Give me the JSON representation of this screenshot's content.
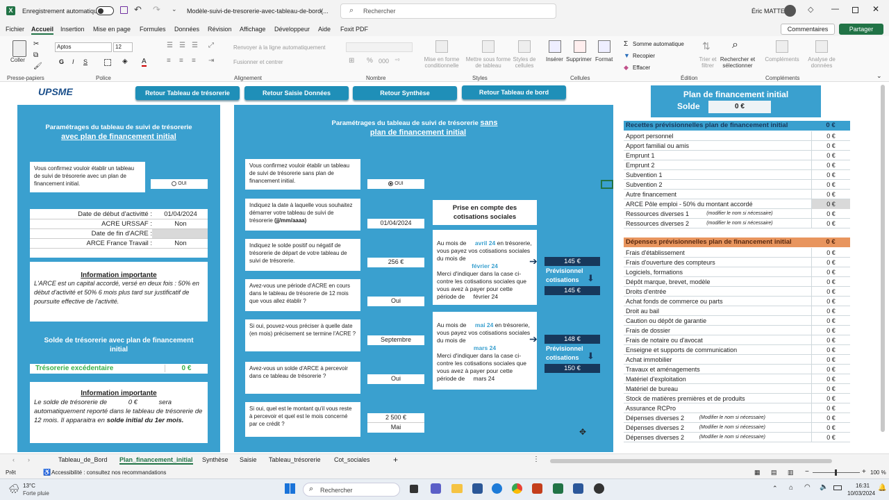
{
  "titlebar": {
    "autosave": "Enregistrement automatique",
    "filename": "Modèle-suivi-de-tresorerie-avec-tableau-de-bord(...",
    "search": "Rechercher",
    "user": "Éric MATTEI"
  },
  "menu": [
    "Fichier",
    "Accueil",
    "Insertion",
    "Mise en page",
    "Formules",
    "Données",
    "Révision",
    "Affichage",
    "Développeur",
    "Aide",
    "Foxit PDF"
  ],
  "menu_right": {
    "comments": "Commentaires",
    "share": "Partager"
  },
  "ribbon": {
    "coller": "Coller",
    "presse": "Presse-papiers",
    "font": "Aptos",
    "size": "12",
    "police": "Police",
    "wrap": "Renvoyer à la ligne automatiquement",
    "merge": "Fusionner et centrer",
    "alignement": "Alignement",
    "nombre": "Nombre",
    "mef_cond": "Mise en forme conditionnelle",
    "mef_tab": "Mettre sous forme de tableau",
    "styles_cell": "Styles de cellules",
    "styles": "Styles",
    "inserer": "Insérer",
    "supprimer": "Supprimer",
    "format": "Format",
    "cellules": "Cellules",
    "somme": "Somme automatique",
    "recopier": "Recopier",
    "effacer": "Effacer",
    "trier": "Trier et filtrer",
    "rechercher": "Rechercher et sélectionner",
    "edition": "Édition",
    "complements": "Compléments",
    "complements_grp": "Compléments",
    "analyse": "Analyse de données"
  },
  "nav": {
    "b1": "Retour Tableau de trésorerie",
    "b2": "Retour Saisie Données",
    "b3": "Retour Synthèse",
    "b4": "Retour Tableau de bord"
  },
  "logo": "UPSME",
  "left": {
    "title1": "Paramétrages du tableau de suivi de trésorerie",
    "title2": "avec plan de financement initial",
    "confirm": "Vous confirmez vouloir établir un tableau de suivi de trésorerie avec un plan de financement initial.",
    "radio": "OUI",
    "date_label": "Date de début d'activitté :",
    "date_val": "01/04/2024",
    "acre_label": "ACRE URSSAF :",
    "acre_val": "Non",
    "fin_label": "Date de fin d'ACRE :",
    "fin_val": "",
    "ft_label": "ARCE France Travail :",
    "ft_val": "Non",
    "info_title": "Information importante",
    "info_text": "L'ARCE est un capital accordé, versé en deux fois : 50% en début d'activité et 50% 6 mois plus tard sur justificatif de poursuite effective de l'activité.",
    "solde_title": "Solde de trésorerie avec plan de financement initial",
    "treso_label": "Trésorerie excédentaire",
    "treso_val": "0 €",
    "info2_title": "Information importante",
    "info2_a": "Le solde de trésorerie de",
    "info2_val": "0 €",
    "info2_b": "sera automatiquement reporté dans le tableau de trésorerie de 12 mois. Il apparaitra en",
    "info2_c": "solde initial du 1er mois."
  },
  "mid": {
    "title1": "Paramétrages du tableau de suivi de trésorerie",
    "title1b": "sans",
    "title2": "plan de financement initial",
    "q1": "Vous confirmez vouloir établir un tableau de suivi de trésorerie sans plan de financement initial.",
    "a1": "OUI",
    "q2": "Indiquez la date à laquelle vous souhaitez démarrer votre tableau de suivi de trésorerie",
    "q2b": "(jj/mm/aaaa)",
    "a2": "01/04/2024",
    "q3": "Indiquez le solde positif ou négatif de trésorerie de départ de votre tableau de suivi de trésorerie.",
    "a3": "256 €",
    "q4": "Avez-vous une période d'ACRE en cours dans le tableau de trésorerie de 12 mois que vous allez établir ?",
    "a4": "Oui",
    "q5": "Si oui, pouvez-vous préciser à quelle date (en mois) précisement se termine l'ACRE ?",
    "a5": "Septembre",
    "q6": "Avez-vous  un solde d'ARCE à percevoir dans ce tableau de trésorerie ?",
    "a6": "Oui",
    "q7": "Si oui, quel est le montant qu'il vous reste à percevoir et quel est le mois concerné par ce crédit ?",
    "a7": "2 500 €",
    "a7b": "Mai",
    "cot_title": "Prise en compte des cotisations sociales",
    "c1_a": "Au mois de",
    "c1_m": "avril 24",
    "c1_b": "en trésorerie, vous payez vos cotisations sociales du mois de",
    "c1_m2": "février 24",
    "c1_c": "Merci d'indiquer dans la case ci-contre les cotisations sociales que vous avez à payer pour cette période de",
    "c1_m3": "février 24",
    "c1_v1": "145 €",
    "c1_prev": "Prévisionnel cotisations",
    "c1_v2": "145 €",
    "c2_a": "Au mois de",
    "c2_m": "mai 24",
    "c2_b": "en trésorerie, vous payez vos cotisations sociales du mois de",
    "c2_m2": "mars 24",
    "c2_c": "Merci d'indiquer dans la case ci-contre les cotisations sociales que vous avez à payer pour cette période de",
    "c2_m3": "mars 24",
    "c2_v1": "148 €",
    "c2_prev": "Prévisionnel cotisations",
    "c2_v2": "150 €"
  },
  "right": {
    "title": "Plan de financement initial",
    "solde": "Solde",
    "solde_val": "0 €",
    "rec_header": "Recettes prévisionnelles plan de financement initial",
    "rec_total": "0 €",
    "recettes": [
      {
        "l": "Apport personnel",
        "v": "0 €"
      },
      {
        "l": "Apport familial ou amis",
        "v": "0 €"
      },
      {
        "l": "Emprunt 1",
        "v": "0 €"
      },
      {
        "l": "Emprunt 2",
        "v": "0 €"
      },
      {
        "l": "Subvention 1",
        "v": "0 €"
      },
      {
        "l": "Subvention 2",
        "v": "0 €"
      },
      {
        "l": "Autre financement",
        "v": "0 €"
      },
      {
        "l": "ARCE Pôle emploi - 50% du montant accordé",
        "v": "0 €"
      },
      {
        "l": "Ressources diverses 1",
        "n": "(modifier le nom si nécessaire)",
        "v": "0 €"
      },
      {
        "l": "Ressources diverses 2",
        "n": "(modifier le nom si nécessaire)",
        "v": "0 €"
      }
    ],
    "dep_header": "Dépenses prévisionnelles plan de financement initial",
    "dep_total": "0 €",
    "depenses": [
      {
        "l": "Frais d'établissement",
        "v": "0 €"
      },
      {
        "l": "Frais d'ouverture des compteurs",
        "v": "0 €"
      },
      {
        "l": "Logiciels, formations",
        "v": "0 €"
      },
      {
        "l": "Dépôt marque, brevet, modèle",
        "v": "0 €"
      },
      {
        "l": "Droits d'entrée",
        "v": "0 €"
      },
      {
        "l": "Achat fonds de commerce ou parts",
        "v": "0 €"
      },
      {
        "l": "Droit au bail",
        "v": "0 €"
      },
      {
        "l": "Caution ou dépôt de garantie",
        "v": "0 €"
      },
      {
        "l": "Frais de dossier",
        "v": "0 €"
      },
      {
        "l": "Frais de notaire ou d'avocat",
        "v": "0 €"
      },
      {
        "l": "Enseigne et supports de communication",
        "v": "0 €"
      },
      {
        "l": "Achat immobilier",
        "v": "0 €"
      },
      {
        "l": "Travaux et aménagements",
        "v": "0 €"
      },
      {
        "l": "Matériel d'exploitation",
        "v": "0 €"
      },
      {
        "l": "Matériel de bureau",
        "v": "0 €"
      },
      {
        "l": "Stock de matières premières et de produits",
        "v": "0 €"
      },
      {
        "l": "Assurance RCPro",
        "v": "0 €"
      },
      {
        "l": "Dépenses diverses 2",
        "n": "(Modifier le nom si nécessaire)",
        "v": "0 €"
      },
      {
        "l": "Dépenses diverses 2",
        "n": "(Modifier le nom si nécessaire)",
        "v": "0 €"
      },
      {
        "l": "Dépenses diverses 2",
        "n": "(Modifier le nom si nécessaire)",
        "v": "0 €"
      }
    ]
  },
  "tabs": [
    "Tableau_de_Bord",
    "Plan_financement_initial",
    "Synthèse",
    "Saisie",
    "Tableau_trésorerie",
    "Cot_sociales"
  ],
  "status": {
    "ready": "Prêt",
    "access": "Accessibilité : consultez nos recommandations",
    "zoom": "100 %"
  },
  "taskbar": {
    "temp": "13°C",
    "weather": "Forte pluie",
    "search": "Rechercher",
    "time": "16:31",
    "date": "10/03/2024"
  },
  "colors": {
    "panel": "#3aa0cf",
    "navy": "#17385c",
    "excel_green": "#217346",
    "rec_header": "#3aa0cf",
    "dep_header": "#e8955e"
  }
}
